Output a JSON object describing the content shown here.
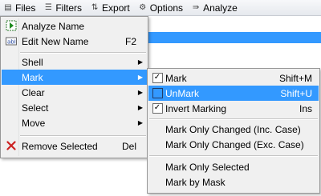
{
  "toolbar": {
    "items": [
      {
        "label": "Files",
        "icon": "files-icon"
      },
      {
        "label": "Filters",
        "icon": "filters-icon"
      },
      {
        "label": "Export",
        "icon": "export-icon"
      },
      {
        "label": "Options",
        "icon": "options-icon"
      },
      {
        "label": "Analyze",
        "icon": "analyze-icon"
      }
    ]
  },
  "main_menu": {
    "items": [
      {
        "label": "Analyze Name",
        "shortcut": "",
        "icon": "analyze-name-icon"
      },
      {
        "label": "Edit New Name",
        "shortcut": "F2",
        "icon": "edit-name-icon"
      },
      {
        "label": "Shell",
        "submenu": true
      },
      {
        "label": "Mark",
        "submenu": true,
        "highlighted": true
      },
      {
        "label": "Clear",
        "submenu": true
      },
      {
        "label": "Select",
        "submenu": true
      },
      {
        "label": "Move",
        "submenu": true
      },
      {
        "label": "Remove Selected",
        "shortcut": "Del",
        "icon": "remove-icon"
      }
    ]
  },
  "sub_menu": {
    "items": [
      {
        "label": "Mark",
        "shortcut": "Shift+M",
        "checked": true
      },
      {
        "label": "UnMark",
        "shortcut": "Shift+U",
        "checked": false,
        "highlighted": true
      },
      {
        "label": "Invert Marking",
        "shortcut": "Ins",
        "checked": true
      },
      {
        "label": "Mark Only Changed (Inc. Case)",
        "shortcut": ""
      },
      {
        "label": "Mark Only Changed (Exc. Case)",
        "shortcut": ""
      },
      {
        "label": "Mark Only Selected",
        "shortcut": ""
      },
      {
        "label": "Mark by Mask",
        "shortcut": ""
      }
    ]
  },
  "colors": {
    "highlight": "#3399ff",
    "remove_icon": "#cc2222"
  }
}
